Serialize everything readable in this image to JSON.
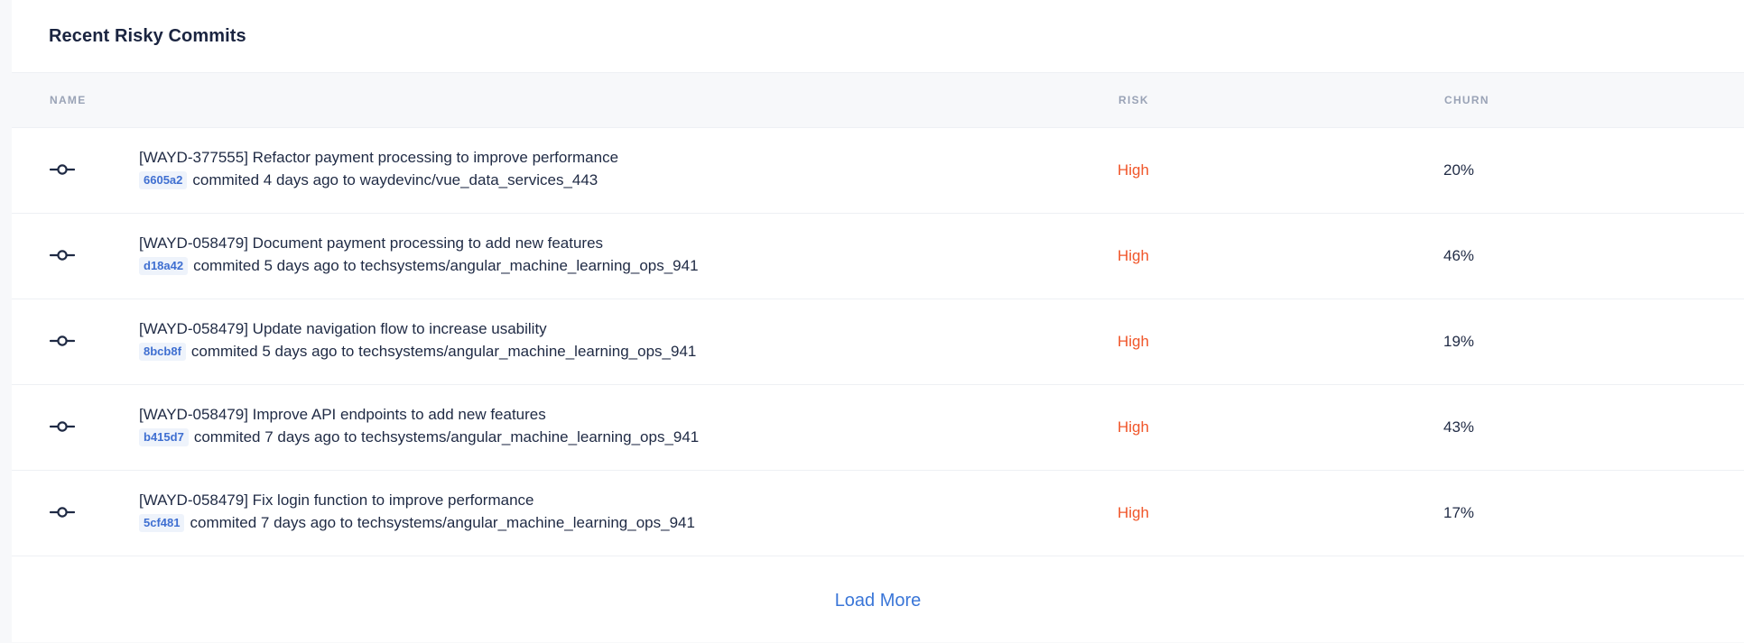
{
  "card": {
    "title": "Recent Risky Commits"
  },
  "table": {
    "columns": {
      "name": "NAME",
      "risk": "RISK",
      "churn": "CHURN"
    },
    "rows": [
      {
        "icon": "commit-icon",
        "title": "[WAYD-377555] Refactor payment processing to improve performance",
        "sha": "6605a2",
        "meta": "commited 4 days ago to waydevinc/vue_data_services_443",
        "risk": "High",
        "churn": "20%"
      },
      {
        "icon": "commit-icon",
        "title": "[WAYD-058479] Document payment processing to add new features",
        "sha": "d18a42",
        "meta": "commited 5 days ago to techsystems/angular_machine_learning_ops_941",
        "risk": "High",
        "churn": "46%"
      },
      {
        "icon": "commit-icon",
        "title": "[WAYD-058479] Update navigation flow to increase usability",
        "sha": "8bcb8f",
        "meta": "commited 5 days ago to techsystems/angular_machine_learning_ops_941",
        "risk": "High",
        "churn": "19%"
      },
      {
        "icon": "commit-icon",
        "title": "[WAYD-058479] Improve API endpoints to add new features",
        "sha": "b415d7",
        "meta": "commited 7 days ago to techsystems/angular_machine_learning_ops_941",
        "risk": "High",
        "churn": "43%"
      },
      {
        "icon": "commit-icon",
        "title": "[WAYD-058479] Fix login function to improve performance",
        "sha": "5cf481",
        "meta": "commited 7 days ago to techsystems/angular_machine_learning_ops_941",
        "risk": "High",
        "churn": "17%"
      }
    ]
  },
  "footer": {
    "load_more_label": "Load More"
  },
  "colors": {
    "risk_high": "#f0562a",
    "link": "#3a76d8",
    "sha_text": "#3f6fd1",
    "sha_bg": "#eef3fb"
  }
}
